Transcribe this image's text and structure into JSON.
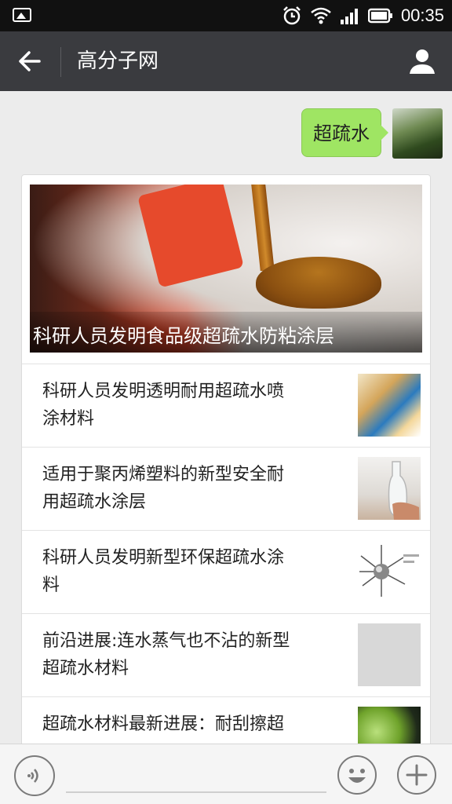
{
  "status_bar": {
    "time": "00:35",
    "icons": [
      "image-notification-icon",
      "alarm-icon",
      "wifi-icon",
      "signal-icon",
      "battery-icon"
    ]
  },
  "nav": {
    "title": "高分子网",
    "back_icon": "back-arrow-icon",
    "profile_icon": "user-icon"
  },
  "chat": {
    "message": "超疏水",
    "bubble_color": "#9fe563"
  },
  "card": {
    "hero_caption": "科研人员发明食品级超疏水防粘涂层",
    "items": [
      {
        "title": "科研人员发明透明耐用超疏水喷涂材料",
        "line1": "科研人员发明透明耐用超疏水喷",
        "line2": "涂材料"
      },
      {
        "title": "适用于聚丙烯塑料的新型安全耐用超疏水涂层",
        "line1": "适用于聚丙烯塑料的新型安全耐",
        "line2": "用超疏水涂层"
      },
      {
        "title": "科研人员发明新型环保超疏水涂料",
        "line1": "科研人员发明新型环保超疏水涂",
        "line2": "料"
      },
      {
        "title": "前沿进展:连水蒸气也不沾的新型超疏水材料",
        "line1": "前沿进展:连水蒸气也不沾的新型",
        "line2": "超疏水材料"
      },
      {
        "title": "超疏水材料最新进展：耐刮擦超",
        "line1": "超疏水材料最新进展：耐刮擦超",
        "line2": ""
      }
    ]
  },
  "input_bar": {
    "voice_icon": "voice-icon",
    "emoji_icon": "emoji-icon",
    "plus_icon": "plus-icon"
  },
  "colors": {
    "nav_bg": "#3a3b3f",
    "status_bg": "#111111",
    "page_bg": "#ececec"
  }
}
